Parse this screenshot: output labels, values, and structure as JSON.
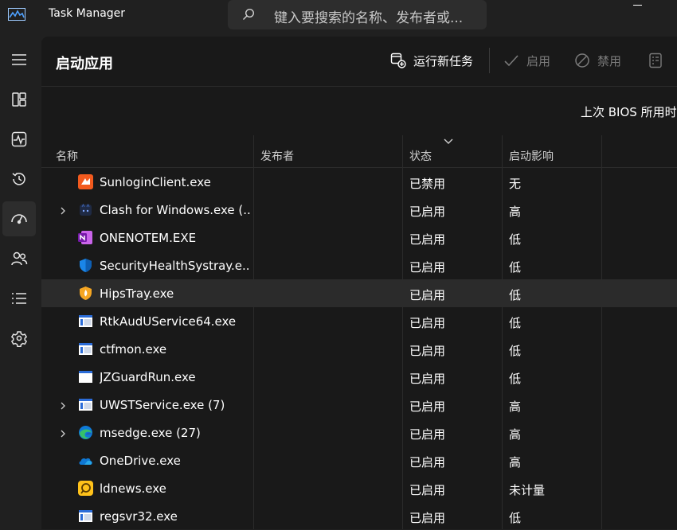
{
  "titlebar": {
    "app_title": "Task Manager",
    "search_placeholder": "键入要搜索的名称、发布者或..."
  },
  "nav": {
    "items": [
      {
        "icon": "hamburger-menu-icon"
      },
      {
        "icon": "processes-icon"
      },
      {
        "icon": "performance-icon"
      },
      {
        "icon": "app-history-icon"
      },
      {
        "icon": "startup-apps-icon",
        "active": true
      },
      {
        "icon": "users-icon"
      },
      {
        "icon": "details-icon"
      },
      {
        "icon": "services-icon"
      }
    ]
  },
  "header": {
    "title": "启动应用",
    "run_new_task": "运行新任务",
    "enable": "启用",
    "disable": "禁用",
    "bios_time": "上次 BIOS 所用时间"
  },
  "columns": {
    "name": "名称",
    "publisher": "发布者",
    "status": "状态",
    "impact": "启动影响"
  },
  "rows": [
    {
      "name": "SunloginClient.exe",
      "publisher": "",
      "status": "已禁用",
      "impact": "无",
      "expandable": false,
      "icon": "sunlogin-icon"
    },
    {
      "name": "Clash for Windows.exe (...",
      "publisher": "",
      "status": "已启用",
      "impact": "高",
      "expandable": true,
      "icon": "clash-icon"
    },
    {
      "name": "ONENOTEM.EXE",
      "publisher": "",
      "status": "已启用",
      "impact": "低",
      "expandable": false,
      "icon": "onenote-icon"
    },
    {
      "name": "SecurityHealthSystray.e...",
      "publisher": "",
      "status": "已启用",
      "impact": "低",
      "expandable": false,
      "icon": "security-shield-icon"
    },
    {
      "name": "HipsTray.exe",
      "publisher": "",
      "status": "已启用",
      "impact": "低",
      "expandable": false,
      "icon": "hips-shield-icon",
      "selected": true
    },
    {
      "name": "RtkAudUService64.exe",
      "publisher": "",
      "status": "已启用",
      "impact": "低",
      "expandable": false,
      "icon": "generic-app-icon"
    },
    {
      "name": "ctfmon.exe",
      "publisher": "",
      "status": "已启用",
      "impact": "低",
      "expandable": false,
      "icon": "generic-app-icon"
    },
    {
      "name": "JZGuardRun.exe",
      "publisher": "",
      "status": "已启用",
      "impact": "低",
      "expandable": false,
      "icon": "blank-window-icon"
    },
    {
      "name": "UWSTService.exe (7)",
      "publisher": "",
      "status": "已启用",
      "impact": "高",
      "expandable": true,
      "icon": "generic-app-icon"
    },
    {
      "name": "msedge.exe (27)",
      "publisher": "",
      "status": "已启用",
      "impact": "高",
      "expandable": true,
      "icon": "edge-icon"
    },
    {
      "name": "OneDrive.exe",
      "publisher": "",
      "status": "已启用",
      "impact": "高",
      "expandable": false,
      "icon": "onedrive-cloud-icon"
    },
    {
      "name": "ldnews.exe",
      "publisher": "",
      "status": "已启用",
      "impact": "未计量",
      "expandable": false,
      "icon": "ldnews-icon"
    },
    {
      "name": "regsvr32.exe",
      "publisher": "",
      "status": "已启用",
      "impact": "低",
      "expandable": false,
      "icon": "generic-app-icon"
    }
  ]
}
